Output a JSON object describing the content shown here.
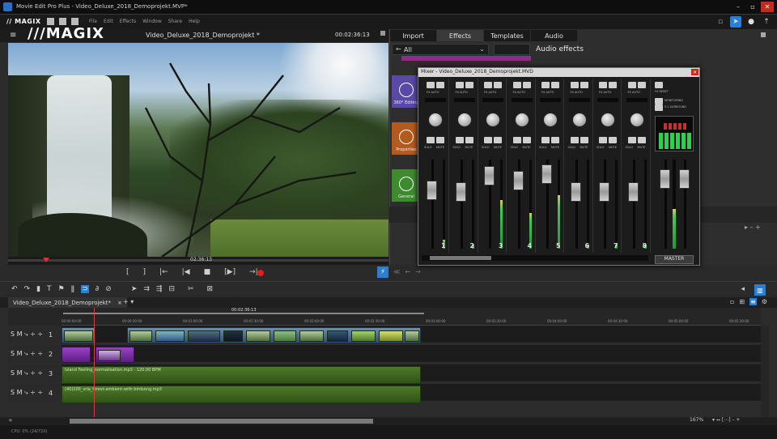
{
  "window": {
    "title": "Movie Edit Pro Plus - Video_Deluxe_2018_Demoprojekt.MVP*"
  },
  "menu": {
    "logo": "// MAGIX",
    "items": [
      "File",
      "Edit",
      "Effects",
      "Window",
      "Share",
      "Help"
    ]
  },
  "player": {
    "logo": "///MAGIX",
    "project": "Video_Deluxe_2018_Demoprojekt *",
    "timecode": "00:02:36:13",
    "scrub_timecode": "02:36:13",
    "marker_position_percent": 10,
    "transport": [
      "[",
      "]",
      "|←",
      "|◀",
      "■",
      "[▶]",
      "→|"
    ]
  },
  "panel": {
    "tabs": [
      "Import",
      "Effects",
      "Templates",
      "Audio"
    ],
    "active_tab": "Effects",
    "dropdown": "All",
    "section_title": "Audio effects",
    "categories": [
      {
        "label": "360° Editing",
        "color": "#5a4aa5"
      },
      {
        "label": "Properties",
        "color": "#b35a1e"
      },
      {
        "label": "General",
        "color": "#3e8a2e"
      }
    ]
  },
  "mixer": {
    "title": "Mixer - Video_Deluxe_2018_Demoprojekt.MVD",
    "fx_label": "FX AUTO",
    "fx_reset": "FX RESET",
    "solo": "SOLO",
    "mute": "MUTE",
    "monitoring": "MONITORING",
    "surround": "5.1 SURROUND",
    "master": "MASTER",
    "channels": [
      {
        "num": "1",
        "level": 0.1
      },
      {
        "num": "2",
        "level": 0.05
      },
      {
        "num": "3",
        "level": 0.55
      },
      {
        "num": "4",
        "level": 0.4
      },
      {
        "num": "5",
        "level": 0.6
      },
      {
        "num": "6",
        "level": 0.05
      },
      {
        "num": "7",
        "level": 0.05
      },
      {
        "num": "8",
        "level": 0.05
      }
    ],
    "master_level": 0.45
  },
  "timeline": {
    "tab": "Video_Deluxe_2018_Demoprojekt*",
    "ruler_timecode": "00:02:36:13",
    "ticks": [
      "00:00:00:00",
      "00:00:30:00",
      "00:01:00:00",
      "00:01:30:00",
      "00:02:00:00",
      "00:02:30:00",
      "00:03:00:00",
      "00:03:30:00",
      "00:04:00:00",
      "00:04:30:00",
      "00:05:00:00",
      "00:05:30:00"
    ],
    "tracks": [
      {
        "num": "1",
        "controls": "S M ⤷ ÷ ÷"
      },
      {
        "num": "2",
        "controls": "S M ⤷ ÷ ÷"
      },
      {
        "num": "3",
        "controls": "S M ⤷ ÷ ÷"
      },
      {
        "num": "4",
        "controls": "S M ⤷ ÷ ÷"
      }
    ],
    "audio_clips": [
      "Island Feeling_normalisation.mp3 - 120.00 BPM",
      "(40)100_vrla_forest-ambient-with-birdsong.mp3"
    ],
    "zoom": "167%"
  },
  "status": {
    "text": "CPU: 0% (24/720)"
  }
}
